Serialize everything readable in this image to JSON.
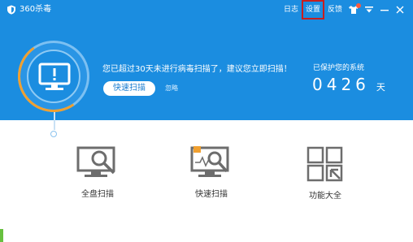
{
  "app": {
    "title": "360杀毒"
  },
  "topnav": {
    "log": "日志",
    "settings": "设置",
    "feedback": "反馈"
  },
  "status": {
    "warning": "您已超过30天未进行病毒扫描了，建议您立即扫描！",
    "quick_scan_button": "快速扫描",
    "ignore_link": "忽略",
    "protected_label": "已保护您的系统",
    "protected_days": "0426",
    "days_unit": "天"
  },
  "tools": [
    {
      "label": "全盘扫描",
      "icon": "full-scan-icon"
    },
    {
      "label": "快速扫描",
      "icon": "quick-scan-icon"
    },
    {
      "label": "功能大全",
      "icon": "all-features-icon"
    }
  ],
  "colors": {
    "header_blue": "#1b8de0",
    "highlight_red": "#c81e1e",
    "progress_orange": "#f0a030",
    "sidebar_green": "#67c03f"
  }
}
